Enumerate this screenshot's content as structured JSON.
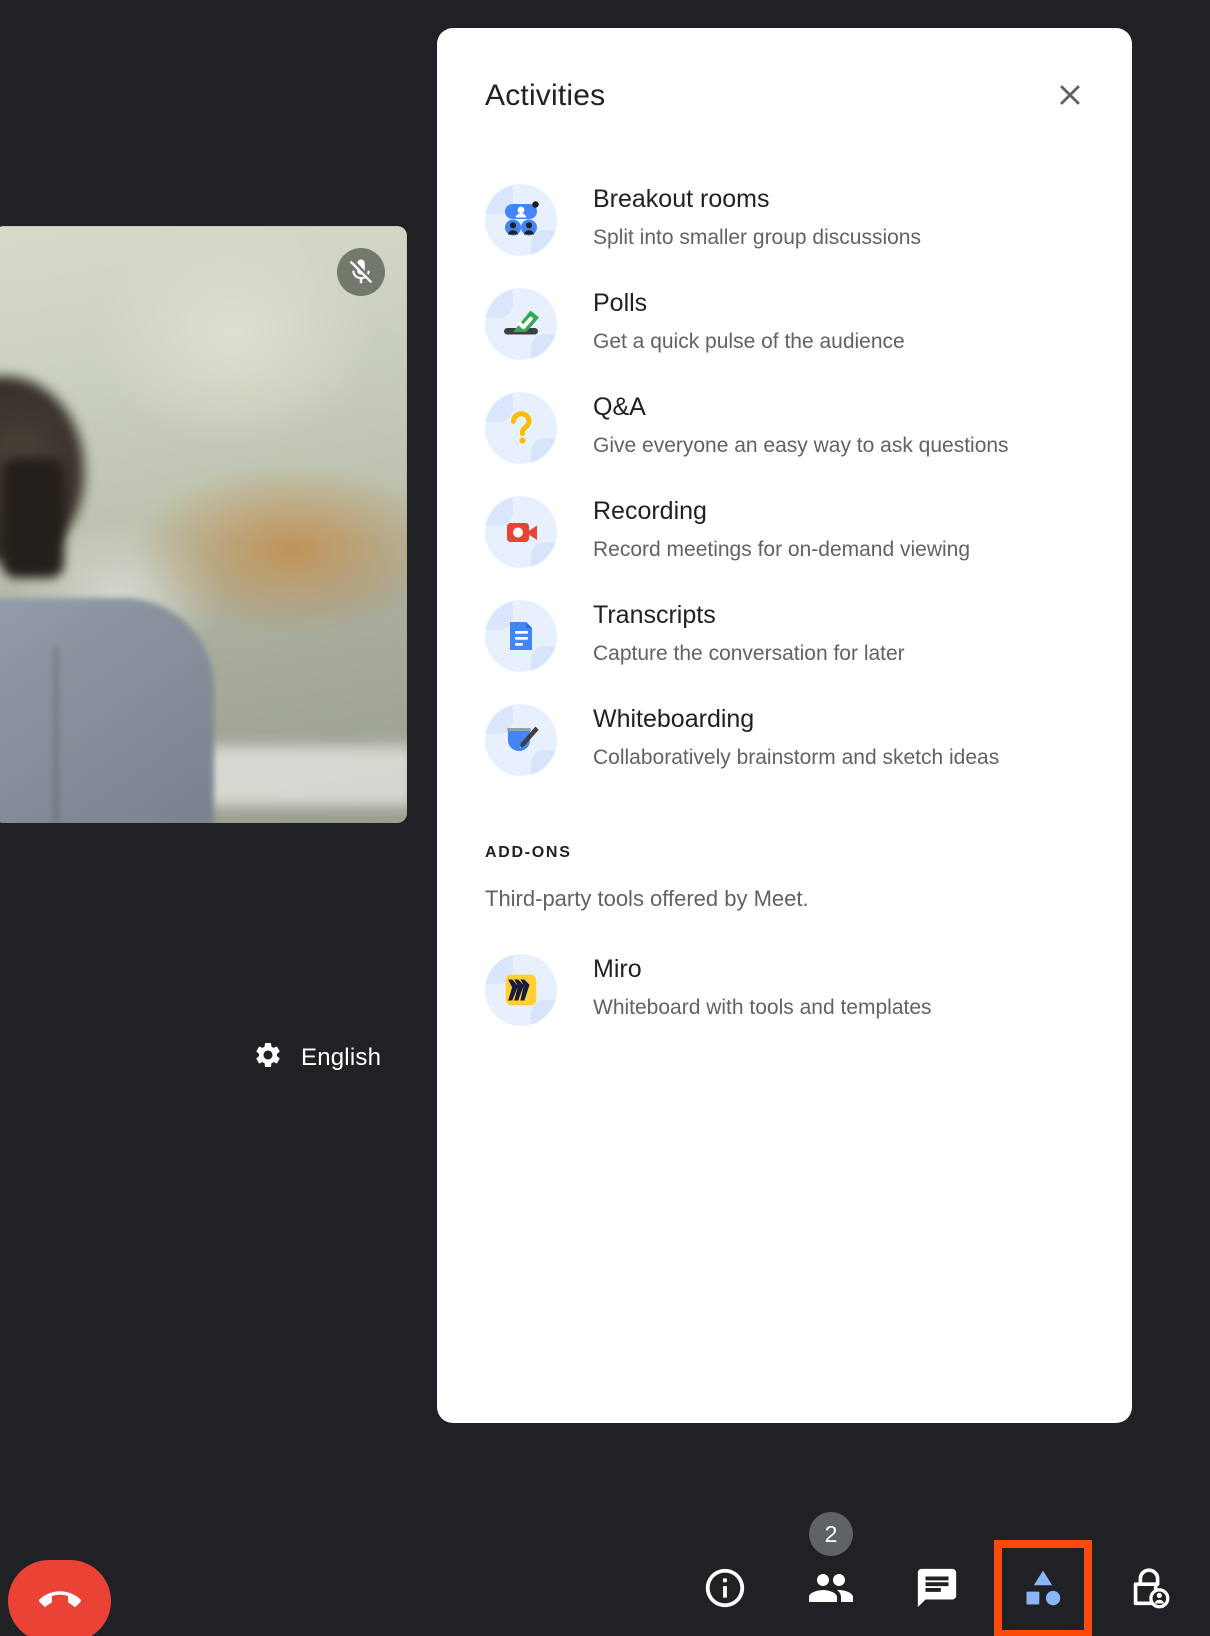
{
  "colors": {
    "app_background": "#202124",
    "panel_background": "#ffffff",
    "accent_blue": "#4285f4",
    "icon_bubble": "#e8f0fe",
    "highlight_orange": "#fb4a0a",
    "hangup_red": "#ea4335",
    "poll_green": "#34a853",
    "qa_yellow": "#fbbc04",
    "record_red": "#ea4335",
    "miro_yellow": "#ffd02f",
    "miro_navy": "#1a1a3d",
    "text_primary": "#202124",
    "text_secondary": "#5f6368"
  },
  "selfview": {
    "mute_icon": "microphone-off-icon",
    "muted": true
  },
  "language_control": {
    "icon": "gear-icon",
    "label": "English"
  },
  "panel": {
    "title": "Activities",
    "close_icon": "close-icon",
    "activities": [
      {
        "icon": "breakout-rooms-icon",
        "title": "Breakout rooms",
        "description": "Split into smaller group discussions"
      },
      {
        "icon": "polls-icon",
        "title": "Polls",
        "description": "Get a quick pulse of the audience"
      },
      {
        "icon": "qa-icon",
        "title": "Q&A",
        "description": "Give everyone an easy way to ask questions"
      },
      {
        "icon": "recording-icon",
        "title": "Recording",
        "description": "Record meetings for on-demand viewing"
      },
      {
        "icon": "transcripts-icon",
        "title": "Transcripts",
        "description": "Capture the conversation for later"
      },
      {
        "icon": "whiteboarding-icon",
        "title": "Whiteboarding",
        "description": "Collaboratively brainstorm and sketch ideas"
      }
    ],
    "addons": {
      "heading": "ADD-ONS",
      "subtitle": "Third-party tools offered by Meet.",
      "items": [
        {
          "icon": "miro-icon",
          "title": "Miro",
          "description": "Whiteboard with tools and templates"
        }
      ]
    }
  },
  "bottom_bar": {
    "hangup": {
      "icon": "end-call-icon",
      "label": ""
    },
    "tools": [
      {
        "icon": "info-icon",
        "name": "meeting-details",
        "badge": null,
        "highlighted": false
      },
      {
        "icon": "people-icon",
        "name": "participants",
        "badge": "2",
        "highlighted": false
      },
      {
        "icon": "chat-icon",
        "name": "chat",
        "badge": null,
        "highlighted": false
      },
      {
        "icon": "activities-icon",
        "name": "activities",
        "badge": null,
        "highlighted": true
      },
      {
        "icon": "host-controls-lock-icon",
        "name": "host-controls",
        "badge": null,
        "highlighted": false
      }
    ]
  }
}
